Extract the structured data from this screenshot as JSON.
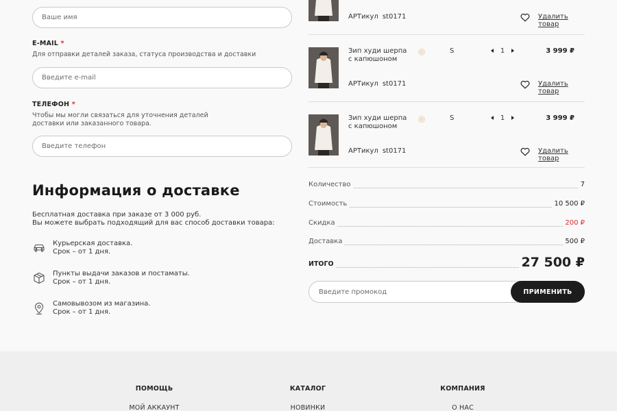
{
  "form": {
    "name_placeholder": "Ваше имя",
    "email_label": "E-MAIL",
    "email_hint": "Для отправки деталей заказа, статуса производства и доставки",
    "email_placeholder": "Введите e-mail",
    "phone_label": "ТЕЛЕФОН",
    "phone_hint_1": "Чтобы мы могли связаться для уточнения деталей",
    "phone_hint_2": "доставки или заказанного товара.",
    "phone_placeholder": "Введите телефон",
    "required_mark": "*"
  },
  "delivery": {
    "title": "Информация о доставке",
    "intro_1": "Бесплатная доставка при заказе от 3 000 руб.",
    "intro_2": "Вы можете выбрать подходящий для вас способ доставки товара:",
    "options": [
      {
        "icon": "car-icon",
        "line1": "Курьерская доставка.",
        "line2": "Срок – от 1 дня."
      },
      {
        "icon": "box-icon",
        "line1": "Пункты выдачи заказов и постаматы.",
        "line2": "Срок – от 1 дня."
      },
      {
        "icon": "location-pin-icon",
        "line1": "Самовывозом из магазина.",
        "line2": "Срок – от 1 дня."
      }
    ]
  },
  "cart": {
    "art_label": "АРТикул",
    "remove_label": "Удалить товар",
    "items": [
      {
        "name_1": "",
        "name_2": "",
        "size": "",
        "qty": "",
        "price": "",
        "art": "st0171",
        "color": "#f6ece0"
      },
      {
        "name_1": "Зип худи шерпа",
        "name_2": "с капюшоном",
        "size": "S",
        "qty": "1",
        "price": "3 999 ₽",
        "art": "st0171",
        "color": "#f6ece0"
      },
      {
        "name_1": "Зип худи шерпа",
        "name_2": "с капюшоном",
        "size": "S",
        "qty": "1",
        "price": "3 999 ₽",
        "art": "st0171",
        "color": "#f6ece0"
      }
    ]
  },
  "summary": {
    "qty_label": "Количество",
    "qty_value": "7",
    "cost_label": "Стоимость",
    "cost_value": "10 500 ₽",
    "discount_label": "Скидка",
    "discount_value": "200 ₽",
    "delivery_label": "Доставка",
    "delivery_value": "500 ₽",
    "total_label": "ИТОГО",
    "total_value": "27 500 ₽",
    "discount_color": "#e0262a"
  },
  "promo": {
    "placeholder": "Введите промокод",
    "apply_label": "ПРИМЕНИТЬ"
  },
  "footer": {
    "columns": [
      {
        "heading": "ПОМОЩЬ",
        "first_link": "МОЙ АККАУНТ"
      },
      {
        "heading": "КАТАЛОГ",
        "first_link": "НОВИНКИ"
      },
      {
        "heading": "КОМПАНИЯ",
        "first_link": "О НАС"
      }
    ]
  }
}
